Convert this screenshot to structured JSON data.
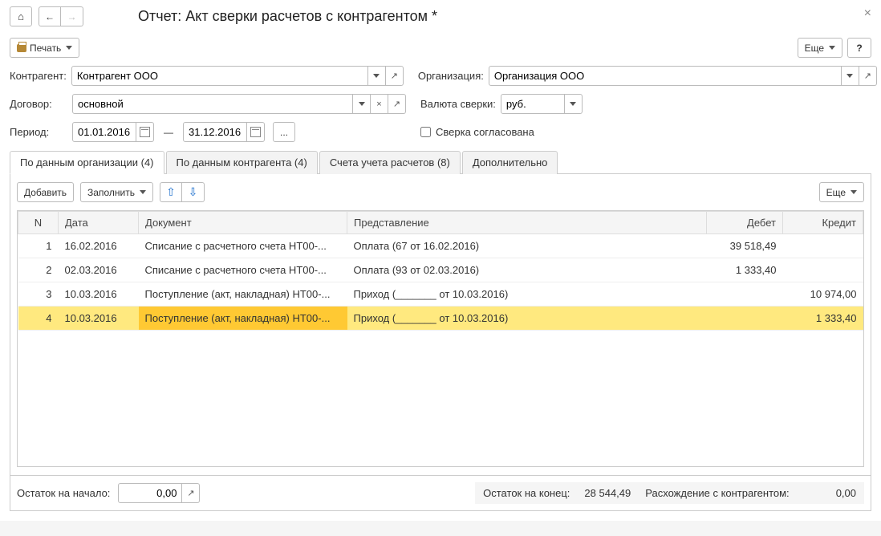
{
  "header": {
    "title": "Отчет: Акт сверки расчетов с контрагентом *"
  },
  "topbar": {
    "print_label": "Печать",
    "more_label": "Еще",
    "help_label": "?"
  },
  "form": {
    "counterparty_label": "Контрагент:",
    "counterparty_value": "Контрагент ООО",
    "org_label": "Организация:",
    "org_value": "Организация ООО",
    "contract_label": "Договор:",
    "contract_value": "основной",
    "currency_label": "Валюта сверки:",
    "currency_value": "руб.",
    "period_label": "Период:",
    "period_from": "01.01.2016",
    "period_to": "31.12.2016",
    "verify_label": "Сверка согласована"
  },
  "tabs": [
    {
      "label": "По данным организации (4)"
    },
    {
      "label": "По данным контрагента (4)"
    },
    {
      "label": "Счета учета расчетов (8)"
    },
    {
      "label": "Дополнительно"
    }
  ],
  "panel_toolbar": {
    "add_label": "Добавить",
    "fill_label": "Заполнить",
    "more_label": "Еще"
  },
  "table": {
    "headers": {
      "n": "N",
      "date": "Дата",
      "doc": "Документ",
      "repr": "Представление",
      "debit": "Дебет",
      "credit": "Кредит"
    },
    "rows": [
      {
        "n": "1",
        "date": "16.02.2016",
        "doc": "Списание с расчетного счета НТ00-...",
        "repr": "Оплата (67 от 16.02.2016)",
        "debit": "39 518,49",
        "credit": ""
      },
      {
        "n": "2",
        "date": "02.03.2016",
        "doc": "Списание с расчетного счета НТ00-...",
        "repr": "Оплата (93 от 02.03.2016)",
        "debit": "1 333,40",
        "credit": ""
      },
      {
        "n": "3",
        "date": "10.03.2016",
        "doc": "Поступление (акт, накладная) НТ00-...",
        "repr": "Приход (_______ от 10.03.2016)",
        "debit": "",
        "credit": "10 974,00"
      },
      {
        "n": "4",
        "date": "10.03.2016",
        "doc": "Поступление (акт, накладная) НТ00-...",
        "repr": "Приход (_______ от 10.03.2016)",
        "debit": "",
        "credit": "1 333,40"
      }
    ]
  },
  "footer": {
    "start_label": "Остаток на начало:",
    "start_value": "0,00",
    "end_label": "Остаток на конец:",
    "end_value": "28 544,49",
    "diff_label": "Расхождение с контрагентом:",
    "diff_value": "0,00"
  }
}
